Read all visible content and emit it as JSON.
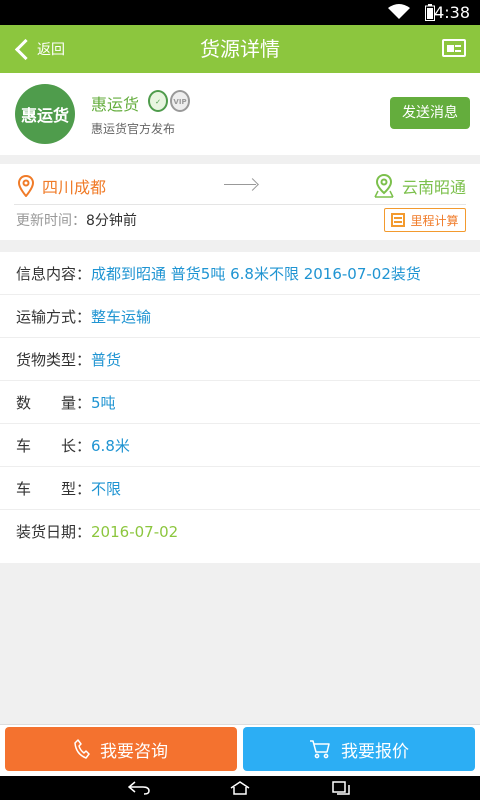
{
  "status_bar": {
    "time": "4:38"
  },
  "app_bar": {
    "back_label": "返回",
    "title": "货源详情"
  },
  "publisher": {
    "logo_text": "惠运货",
    "name": "惠运货",
    "subtitle": "惠运货官方发布",
    "send_button": "发送消息"
  },
  "route": {
    "from": "四川成都",
    "to": "云南昭通",
    "update_label": "更新时间：",
    "update_value": "8分钟前",
    "calc_button": "里程计算"
  },
  "details": [
    {
      "label": "信息内容：",
      "value": "成都到昭通 普货5吨 6.8米不限  2016-07-02装货"
    },
    {
      "label": "运输方式：",
      "value": "整车运输"
    },
    {
      "label": "货物类型：",
      "value": "普货"
    },
    {
      "label": "数　　量：",
      "value": "5吨"
    },
    {
      "label": "车　　长：",
      "value": "6.8米"
    },
    {
      "label": "车　　型：",
      "value": "不限"
    },
    {
      "label": "装货日期：",
      "value": "2016-07-02"
    }
  ],
  "actions": {
    "consult": "我要咨询",
    "quote": "我要报价"
  },
  "colors": {
    "appbar": "#8cc63e",
    "consult": "#f4722f",
    "quote": "#2caef4",
    "from": "#f07b28",
    "to": "#7cc04c"
  }
}
